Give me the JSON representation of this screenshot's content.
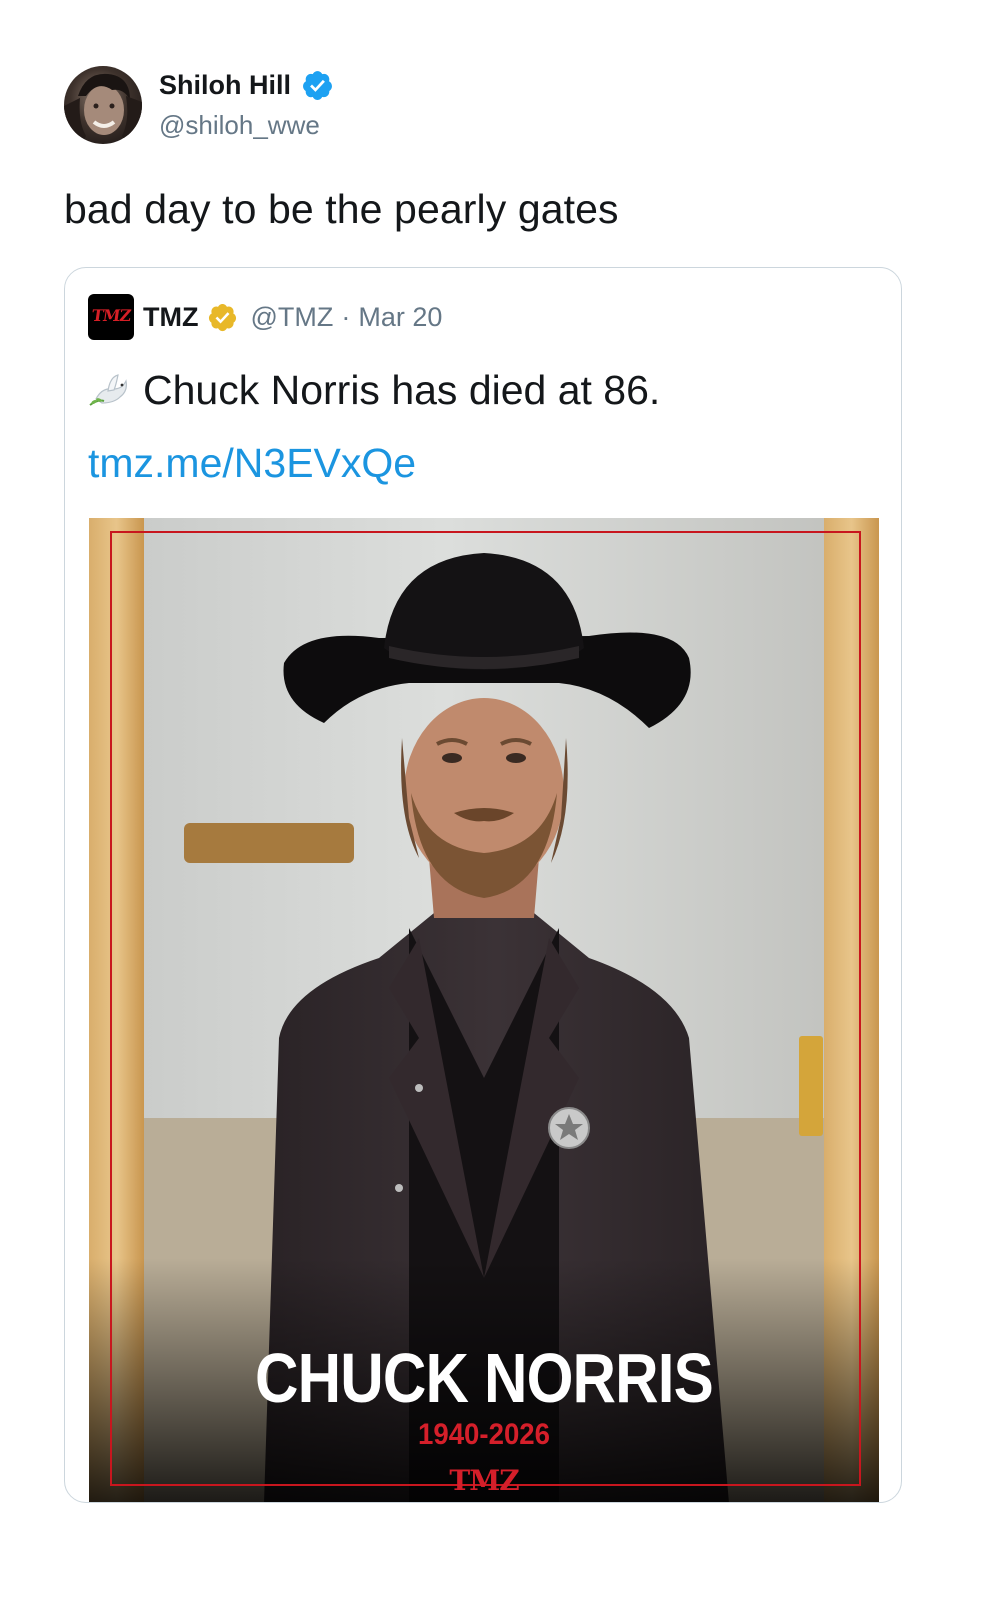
{
  "author": {
    "name": "Shiloh Hill",
    "handle": "@shiloh_wwe",
    "avatar_icon": "avatar-photo",
    "verified_icon": "verified-badge-icon",
    "verified_color": "#1da1f2"
  },
  "tweet": {
    "text": "bad day to be the pearly gates"
  },
  "quoted": {
    "logo_text": "TMZ",
    "name": "TMZ",
    "handle": "@TMZ",
    "separator": "·",
    "date": "Mar 20",
    "verified_icon": "gold-verified-badge-icon",
    "verified_color": "#e8b829",
    "emoji_icon": "dove-icon",
    "text": "Chuck Norris has died at 86.",
    "link": "tmz.me/N3EVxQe",
    "link_color": "#1b95e0"
  },
  "image": {
    "title": "CHUCK NORRIS",
    "years": "1940-2026",
    "logo": "TMZ",
    "accent_color": "#d51f2a"
  }
}
